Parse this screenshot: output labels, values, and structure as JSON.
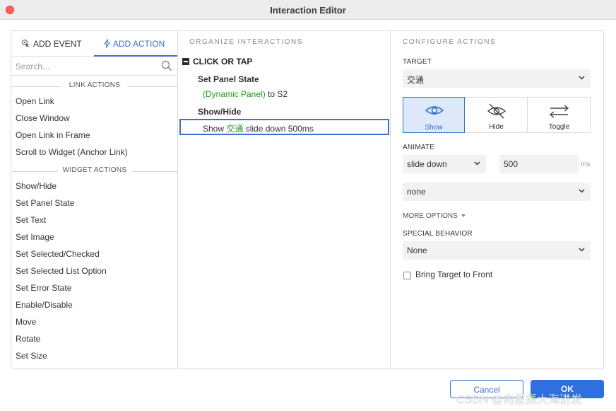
{
  "window": {
    "title": "Interaction Editor"
  },
  "left": {
    "tabs": {
      "event": "ADD EVENT",
      "action": "ADD ACTION"
    },
    "search": {
      "placeholder": "Search..."
    },
    "link_actions": {
      "heading": "LINK ACTIONS",
      "items": [
        "Open Link",
        "Close Window",
        "Open Link in Frame",
        "Scroll to Widget (Anchor Link)"
      ]
    },
    "widget_actions": {
      "heading": "WIDGET ACTIONS",
      "items": [
        "Show/Hide",
        "Set Panel State",
        "Set Text",
        "Set Image",
        "Set Selected/Checked",
        "Set Selected List Option",
        "Set Error State",
        "Enable/Disable",
        "Move",
        "Rotate",
        "Set Size"
      ]
    }
  },
  "middle": {
    "heading": "ORGANIZE INTERACTIONS",
    "event": "CLICK OR TAP",
    "set_panel_state": {
      "title": "Set Panel State",
      "target": "(Dynamic Panel)",
      "rest": " to S2"
    },
    "show_hide": {
      "title": "Show/Hide",
      "prefix": "Show ",
      "target": "交通",
      "rest": " slide down 500ms"
    }
  },
  "right": {
    "heading": "CONFIGURE ACTIONS",
    "target_label": "TARGET",
    "target_value": "交通",
    "visibility": {
      "show": "Show",
      "hide": "Hide",
      "toggle": "Toggle",
      "selected": "Show"
    },
    "animate_label": "ANIMATE",
    "animate_value": "slide down",
    "duration_value": "500",
    "duration_unit": "ms",
    "easing_value": "none",
    "more_options": "MORE OPTIONS",
    "special_label": "SPECIAL BEHAVIOR",
    "special_value": "None",
    "bring_front_label": "Bring Target to Front",
    "bring_front_checked": false
  },
  "footer": {
    "cancel": "Cancel",
    "ok": "OK"
  },
  "watermark": "CSDN @向星辰大海进发",
  "colors": {
    "accent": "#3a6ec8",
    "green_text": "#1f9a1f",
    "close_button": "#fe5f57",
    "ok_button": "#2f6fe0"
  }
}
